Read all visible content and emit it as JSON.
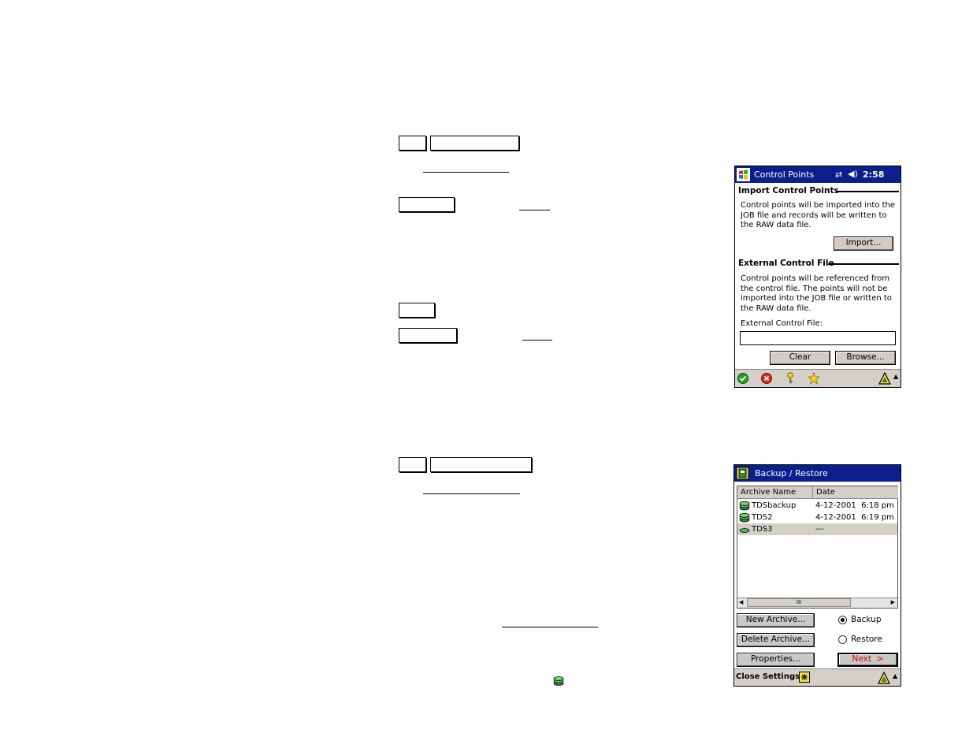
{
  "control_points": {
    "title": "Control Points",
    "status": {
      "time": "2:58"
    },
    "import_section": {
      "heading": "Import Control Points",
      "text": "Control points will be imported into the JOB file and records will be written to the RAW data file.",
      "button": "Import..."
    },
    "external_section": {
      "heading": "External Control File",
      "text": "Control points will be referenced from the control file. The points will not be imported into the JOB file or written to the RAW data file.",
      "field_label": "External Control File:",
      "field_value": "",
      "clear_button": "Clear",
      "browse_button": "Browse..."
    },
    "toolbar_icons": [
      "check-icon",
      "cancel-icon",
      "key-icon",
      "star-icon",
      "tds-logo-icon"
    ]
  },
  "backup_restore": {
    "title": "Backup / Restore",
    "columns": [
      "Archive Name",
      "Date"
    ],
    "rows": [
      {
        "name": "TDSbackup",
        "date": "4-12-2001  6:18 pm"
      },
      {
        "name": "TDS2",
        "date": "4-12-2001  6:19 pm"
      },
      {
        "name": "TDS3",
        "date": "---",
        "selected": true
      }
    ],
    "scroll_grip": "III",
    "new_archive_button": "New Archive...",
    "delete_archive_button": "Delete Archive...",
    "properties_button": "Properties...",
    "next_button": "Next  >",
    "radio_backup": "Backup",
    "radio_restore": "Restore",
    "mode": "Backup",
    "toolbar_label": "Close Settings"
  },
  "colors": {
    "title_bar": "#0a1e8c",
    "next_text": "#d40000",
    "selected_row": "#d4d0c8"
  }
}
